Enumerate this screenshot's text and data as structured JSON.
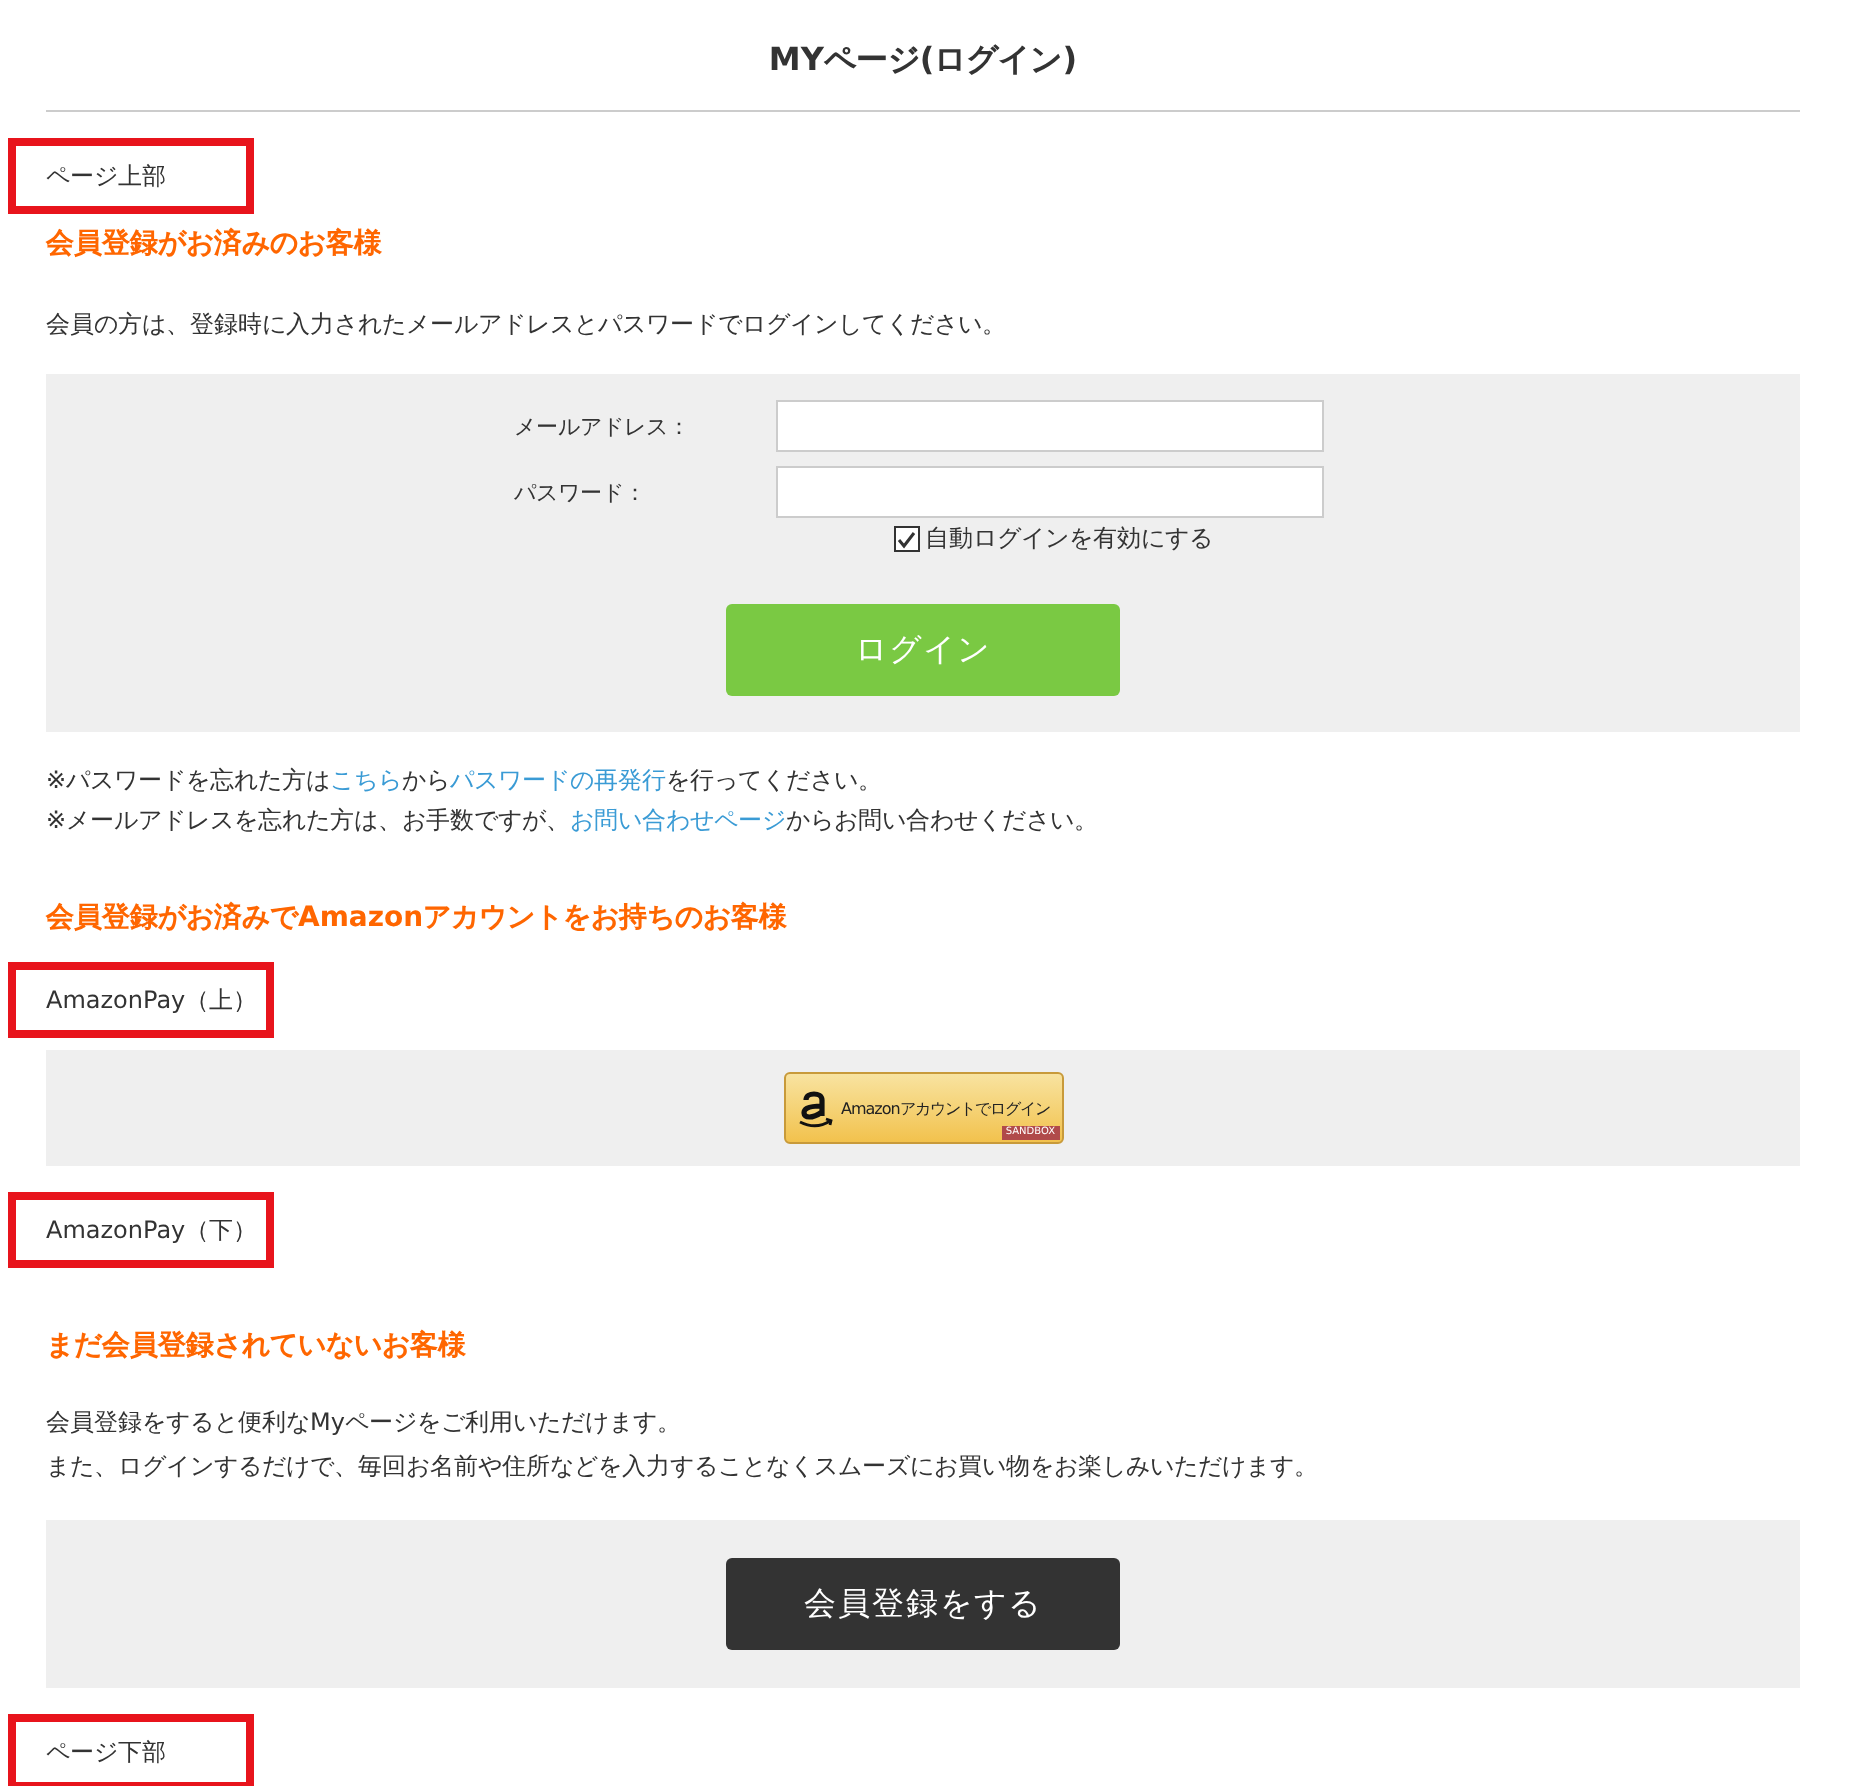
{
  "page_title": "MYページ(ログイン)",
  "sections": [
    {
      "kind": "marker",
      "label": "ページ上部"
    },
    {
      "kind": "login",
      "heading": "会員登録がお済みのお客様",
      "intro": "会員の方は、登録時に入力されたメールアドレスとパスワードでログインしてください。",
      "fields": [
        {
          "label": "メールアドレス："
        },
        {
          "label": "パスワード："
        }
      ],
      "auto_login": {
        "label": "自動ログインを有効にする",
        "checked": true
      },
      "button": "ログイン",
      "notes": [
        [
          {
            "kind": "text",
            "text": "※パスワードを忘れた方は"
          },
          {
            "kind": "link",
            "text": "こちら"
          },
          {
            "kind": "text",
            "text": "から"
          },
          {
            "kind": "link",
            "text": "パスワードの再発行"
          },
          {
            "kind": "text",
            "text": "を行ってください。"
          }
        ],
        [
          {
            "kind": "text",
            "text": "※メールアドレスを忘れた方は、お手数ですが、"
          },
          {
            "kind": "link",
            "text": "お問い合わせページ"
          },
          {
            "kind": "text",
            "text": "からお問い合わせください。"
          }
        ]
      ]
    },
    {
      "kind": "heading",
      "text": "会員登録がお済みでAmazonアカウントをお持ちのお客様"
    },
    {
      "kind": "marker",
      "label": "AmazonPay（上）"
    },
    {
      "kind": "amazon",
      "button": "Amazonアカウントでログイン",
      "badge": "SANDBOX"
    },
    {
      "kind": "marker",
      "label": "AmazonPay（下）"
    },
    {
      "kind": "register",
      "heading": "まだ会員登録されていないお客様",
      "lines": [
        "会員登録をすると便利なMyページをご利用いただけます。",
        "また、ログインするだけで、毎回お名前や住所などを入力することなくスムーズにお買い物をお楽しみいただけます。"
      ],
      "button": "会員登録をする"
    },
    {
      "kind": "marker",
      "label": "ページ下部"
    }
  ]
}
